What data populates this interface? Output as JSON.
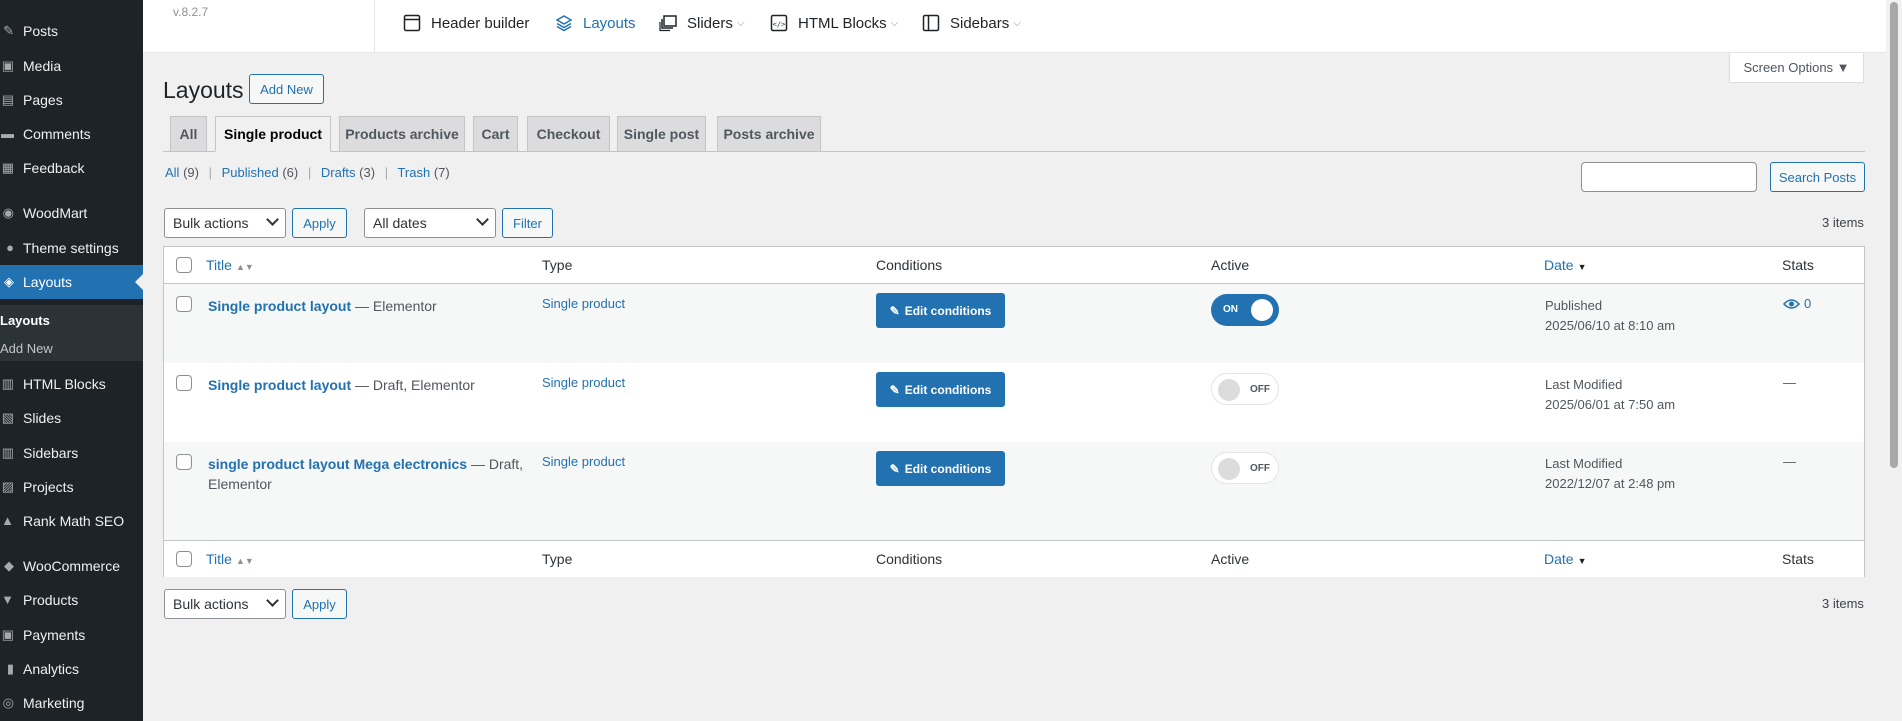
{
  "sidebar": {
    "items": [
      {
        "label": "Posts",
        "icon": "pushpin-icon",
        "glyph": "✎"
      },
      {
        "label": "Media",
        "icon": "media-icon",
        "glyph": "▣"
      },
      {
        "label": "Pages",
        "icon": "pages-icon",
        "glyph": "▤"
      },
      {
        "label": "Comments",
        "icon": "comments-icon",
        "glyph": "▬"
      },
      {
        "label": "Feedback",
        "icon": "feedback-icon",
        "glyph": "▦"
      },
      {
        "label": "WoodMart",
        "icon": "woodmart-icon",
        "glyph": "◉"
      },
      {
        "label": "Theme settings",
        "icon": "settings-icon",
        "glyph": "●"
      },
      {
        "label": "Layouts",
        "icon": "layers-icon",
        "glyph": "◈"
      },
      {
        "label": "HTML Blocks",
        "icon": "html-blocks-icon",
        "glyph": "▥"
      },
      {
        "label": "Slides",
        "icon": "slides-icon",
        "glyph": "▧"
      },
      {
        "label": "Sidebars",
        "icon": "sidebars-icon",
        "glyph": "▥"
      },
      {
        "label": "Projects",
        "icon": "projects-icon",
        "glyph": "▨"
      },
      {
        "label": "Rank Math SEO",
        "icon": "rankmath-icon",
        "glyph": "▲"
      },
      {
        "label": "WooCommerce",
        "icon": "woocommerce-icon",
        "glyph": "◆"
      },
      {
        "label": "Products",
        "icon": "products-icon",
        "glyph": "▼"
      },
      {
        "label": "Payments",
        "icon": "payments-icon",
        "glyph": "▣"
      },
      {
        "label": "Analytics",
        "icon": "analytics-icon",
        "glyph": "▮"
      },
      {
        "label": "Marketing",
        "icon": "marketing-icon",
        "glyph": "◎"
      }
    ],
    "submenu": {
      "current": "Layouts",
      "add_new": "Add New"
    }
  },
  "topbar": {
    "version": "v.8.2.7",
    "items": [
      {
        "label": "Header builder",
        "icon": "header-builder-icon"
      },
      {
        "label": "Layouts",
        "icon": "layouts-icon"
      },
      {
        "label": "Sliders",
        "icon": "sliders-icon"
      },
      {
        "label": "HTML Blocks",
        "icon": "html-blocks-icon"
      },
      {
        "label": "Sidebars",
        "icon": "sidebars-icon"
      }
    ]
  },
  "screen_options": "Screen Options ▼",
  "page": {
    "title": "Layouts",
    "add_new": "Add New"
  },
  "tabs": [
    "All",
    "Single product",
    "Products archive",
    "Cart",
    "Checkout",
    "Single post",
    "Posts archive"
  ],
  "status_links": {
    "all": "All",
    "all_count": "(9)",
    "published": "Published",
    "published_count": "(6)",
    "drafts": "Drafts",
    "drafts_count": "(3)",
    "trash": "Trash",
    "trash_count": "(7)",
    "pipe": "|"
  },
  "search": {
    "button": "Search Posts",
    "value": ""
  },
  "toolbar": {
    "bulk_actions": "Bulk actions",
    "apply": "Apply",
    "all_dates": "All dates",
    "filter": "Filter",
    "items_count": "3 items"
  },
  "table": {
    "columns": {
      "title": "Title",
      "type": "Type",
      "conditions": "Conditions",
      "active": "Active",
      "date": "Date",
      "stats": "Stats"
    },
    "rows": [
      {
        "title": "Single product layout",
        "suffix": " — Elementor",
        "type": "Single product",
        "button": "Edit conditions",
        "toggle": "ON",
        "date_status": "Published",
        "date_value": "2025/06/10 at 8:10 am",
        "stats": "0"
      },
      {
        "title": "Single product layout",
        "suffix": " — Draft, Elementor",
        "type": "Single product",
        "button": "Edit conditions",
        "toggle": "OFF",
        "date_status": "Last Modified",
        "date_value": "2025/06/01 at 7:50 am",
        "stats": "—"
      },
      {
        "title": "single product layout Mega electronics",
        "suffix": " — Draft, Elementor",
        "type": "Single product",
        "button": "Edit conditions",
        "toggle": "OFF",
        "date_status": "Last Modified",
        "date_value": "2022/12/07 at 2:48 pm",
        "stats": "—"
      }
    ]
  },
  "colors": {
    "accent": "#2271b1",
    "sidebar_bg": "#1d2327",
    "page_bg": "#f0f0f1"
  }
}
